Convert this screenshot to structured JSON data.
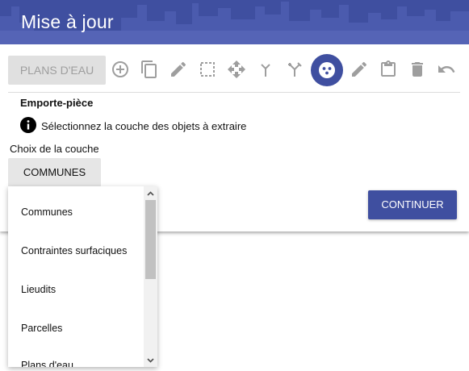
{
  "header": {
    "title": "Mise à jour"
  },
  "toolbar": {
    "layer_button": "PLANS D'EAU",
    "tools": [
      {
        "icon": "add-circle-icon",
        "state": "disabled"
      },
      {
        "icon": "copy-icon",
        "state": "disabled"
      },
      {
        "icon": "pencil-icon",
        "state": "disabled"
      },
      {
        "icon": "dashed-selection-icon",
        "state": "disabled"
      },
      {
        "icon": "move-arrows-icon",
        "state": "disabled"
      },
      {
        "icon": "merge-icon",
        "state": "disabled"
      },
      {
        "icon": "split-icon",
        "state": "disabled"
      },
      {
        "icon": "cookie-cutter-icon",
        "state": "active"
      },
      {
        "icon": "pencil-icon",
        "state": "disabled"
      },
      {
        "icon": "clipboard-icon",
        "state": "disabled"
      },
      {
        "icon": "trash-icon",
        "state": "disabled"
      },
      {
        "icon": "undo-icon",
        "state": "disabled"
      }
    ]
  },
  "tool_panel": {
    "title": "Emporte-pièce",
    "info_text": "Sélectionnez la couche des objets à extraire",
    "field_label": "Choix de la couche",
    "selected_layer": "COMMUNES",
    "continue_label": "CONTINUER"
  },
  "dropdown": {
    "options": [
      "Communes",
      "Contraintes surfaciques",
      "Lieudits",
      "Parcelles",
      "Plans d'eau"
    ]
  },
  "colors": {
    "primary": "#3f4fa0",
    "disabled_icon": "#9e9e9e",
    "disabled_button_bg": "#e0e0e0"
  }
}
